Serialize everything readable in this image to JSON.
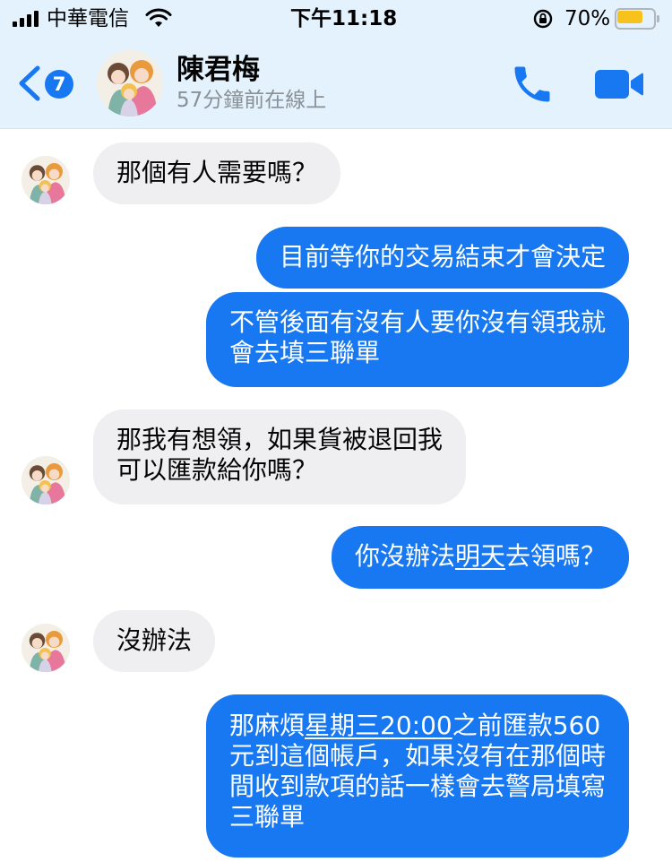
{
  "status_bar": {
    "carrier": "中華電信",
    "time": "下午11:18",
    "battery_text": "70%",
    "battery_level": 0.7,
    "battery_color": "#f7c21b"
  },
  "header": {
    "back_badge_count": "7",
    "contact_name": "陳君梅",
    "contact_status": "57分鐘前在線上",
    "call_icon": "phone-icon",
    "video_icon": "video-camera-icon",
    "accent_color": "#1778f2"
  },
  "messages": [
    {
      "direction": "incoming",
      "lines": [
        "那個有人需要嗎？"
      ]
    },
    {
      "direction": "outgoing",
      "lines": [
        "目前等你的交易結束才會決定"
      ]
    },
    {
      "direction": "outgoing",
      "lines": [
        "不管後面有沒有人要你沒有領我就",
        "會去填三聯單"
      ]
    },
    {
      "direction": "incoming",
      "lines": [
        "那我有想領，如果貨被退回我",
        "可以匯款給你嗎？"
      ]
    },
    {
      "direction": "outgoing",
      "parts": [
        "你沒辦法",
        "明天",
        "去領嗎？"
      ]
    },
    {
      "direction": "incoming",
      "lines": [
        "沒辦法"
      ]
    },
    {
      "direction": "outgoing",
      "line1_parts": [
        "那麻煩",
        "星期三",
        "20:00",
        "之前匯款560"
      ],
      "lines": [
        "元到這個帳戶，如果沒有在那個時",
        "間收到款項的話一樣會去警局填寫",
        "三聯單"
      ]
    }
  ]
}
